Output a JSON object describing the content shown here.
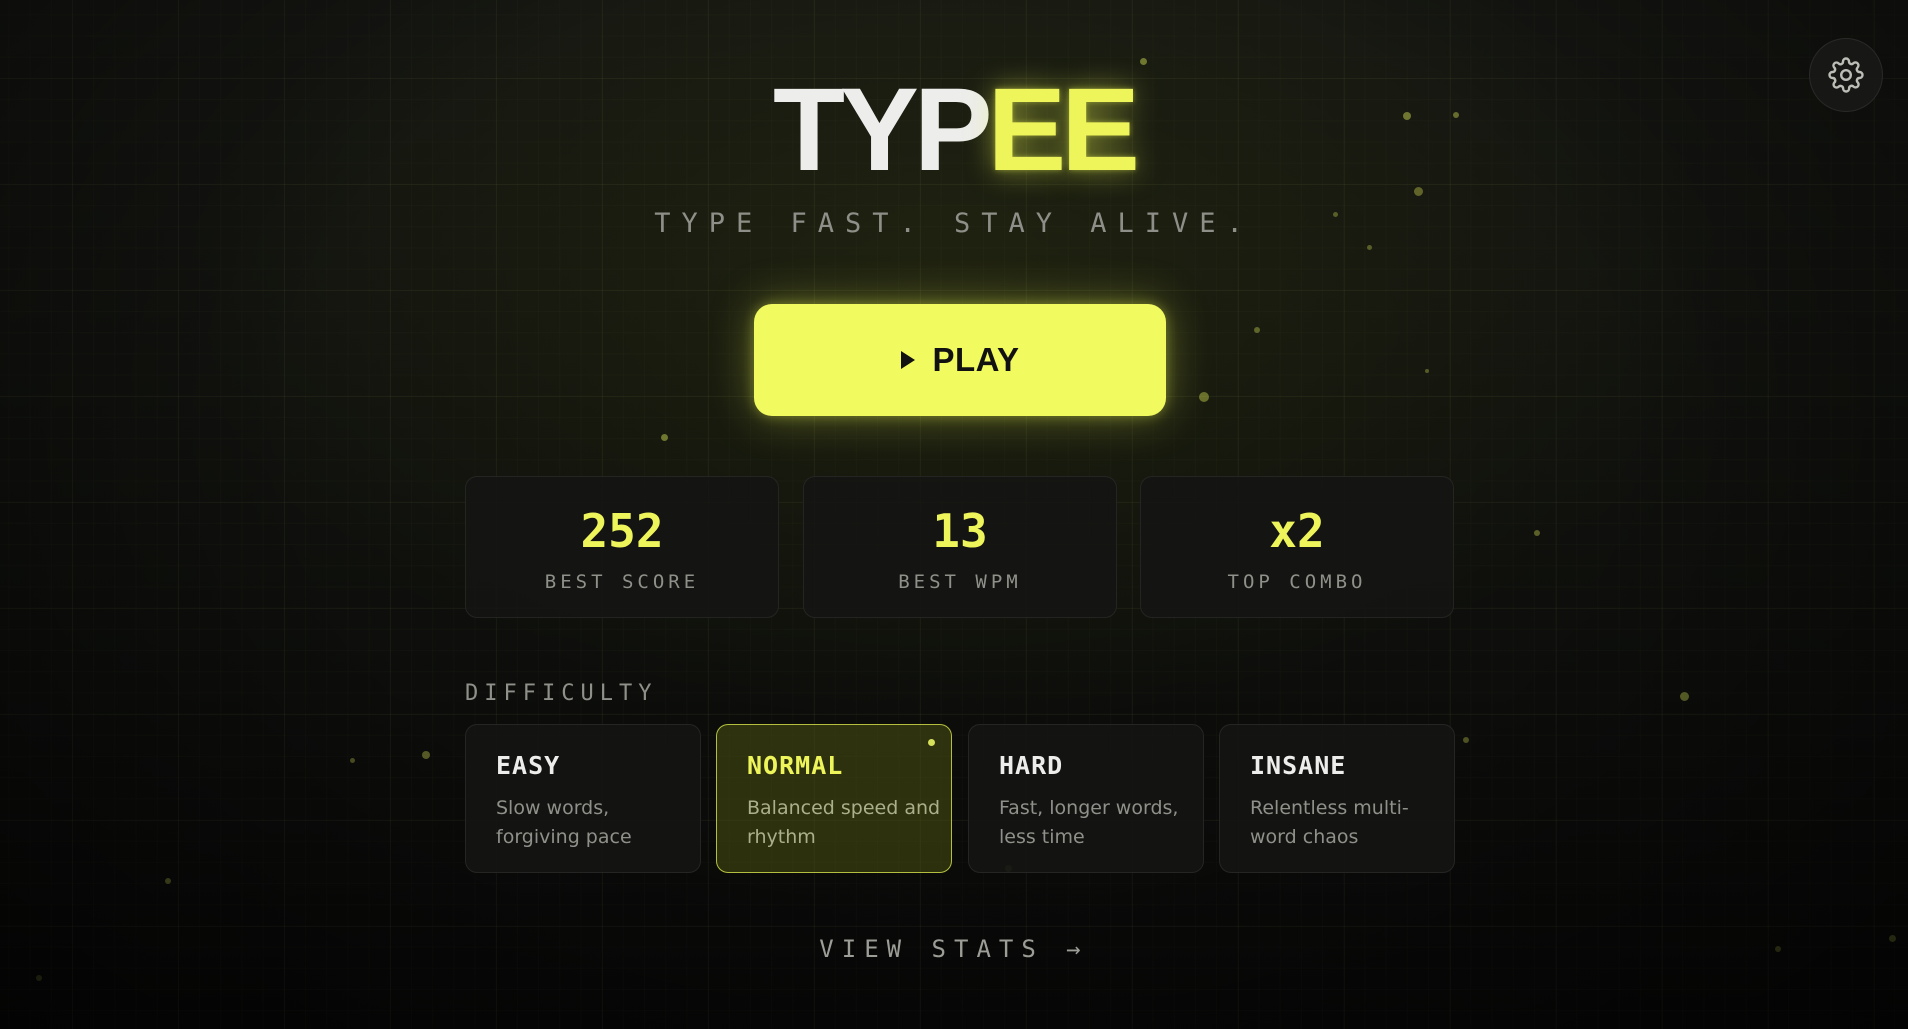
{
  "title": {
    "part_plain": "TYP",
    "part_accent": "EE"
  },
  "tagline": "TYPE FAST. STAY ALIVE.",
  "play": {
    "label": "PLAY",
    "icon": "play-icon"
  },
  "settings": {
    "icon": "gear-icon"
  },
  "stats": [
    {
      "value": "252",
      "label": "BEST SCORE"
    },
    {
      "value": "13",
      "label": "BEST WPM"
    },
    {
      "value": "x2",
      "label": "TOP COMBO"
    }
  ],
  "difficulty": {
    "label": "DIFFICULTY",
    "selected": "NORMAL",
    "options": [
      {
        "name": "EASY",
        "description": "Slow words, forgiving pace"
      },
      {
        "name": "NORMAL",
        "description": "Balanced speed and rhythm"
      },
      {
        "name": "HARD",
        "description": "Fast, longer words, less time"
      },
      {
        "name": "INSANE",
        "description": "Relentless multi-word chaos"
      }
    ]
  },
  "view_stats": {
    "label": "VIEW STATS",
    "arrow": "→"
  },
  "colors": {
    "accent": "#eef55a",
    "play_button": "#f1fa5f",
    "background": "#0b0b0a",
    "muted_text": "#8f908a"
  }
}
